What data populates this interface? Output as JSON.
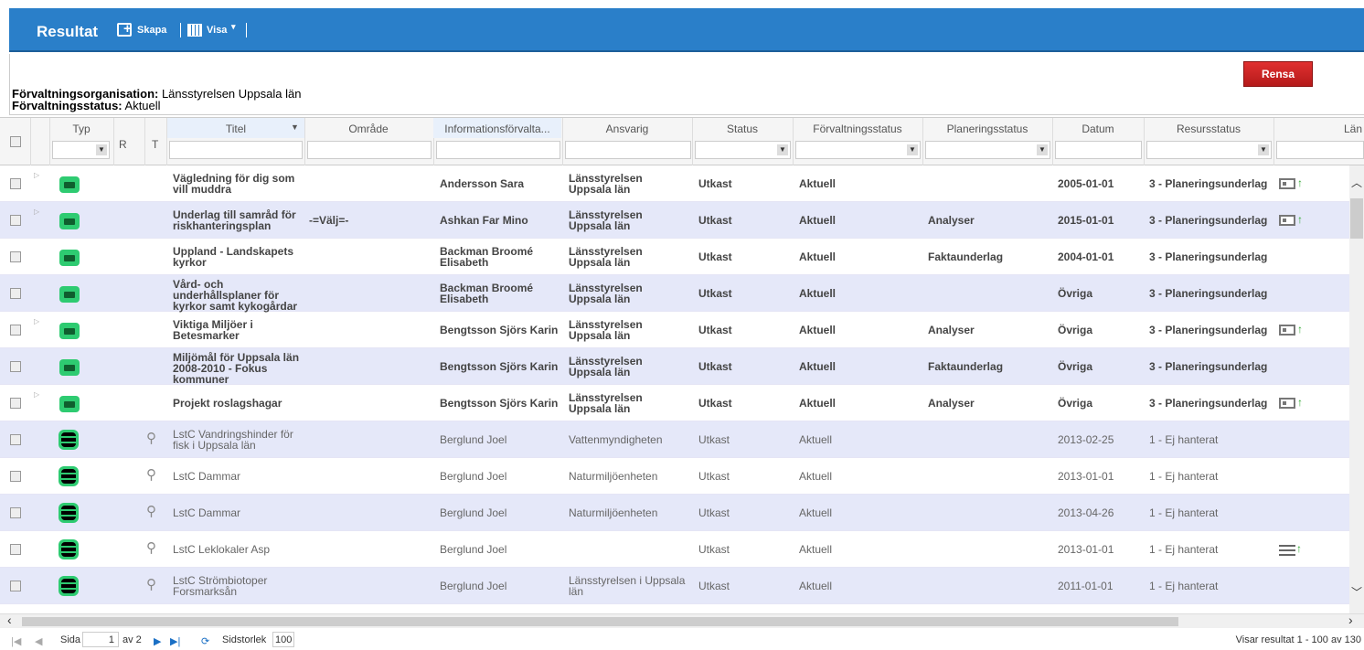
{
  "header": {
    "title": "Resultat",
    "skapa_label": "Skapa",
    "visa_label": "Visa",
    "visa_caret": "▾"
  },
  "filters": {
    "rensa_label": "Rensa",
    "org_label": "Förvaltningsorganisation:",
    "org_value": " Länsstyrelsen Uppsala län",
    "status_label": "Förvaltningsstatus:",
    "status_value": " Aktuell"
  },
  "columns": {
    "typ": "Typ",
    "r": "R",
    "t": "T",
    "titel": "Titel",
    "omrade": "Område",
    "info": "Informationsförvalta...",
    "ansvarig": "Ansvarig",
    "status": "Status",
    "forvaltningsstatus": "Förvaltningsstatus",
    "planeringsstatus": "Planeringsstatus",
    "datum": "Datum",
    "resursstatus": "Resursstatus",
    "lan": "Län"
  },
  "rows": [
    {
      "title1": "Vägledning för dig som",
      "title2": "vill muddra",
      "title3": "",
      "omrade": "",
      "info": "Andersson Sara",
      "ansv1": "Länsstyrelsen",
      "ansv2": "Uppsala län",
      "status": "Utkast",
      "fstatus": "Aktuell",
      "pstatus": "",
      "datum": "2005-01-01",
      "res": "3 - Planeringsunderlag"
    },
    {
      "title1": "Underlag till samråd för",
      "title2": "riskhanteringsplan",
      "title3": "",
      "omrade": "-=Välj=-",
      "info": "Ashkan Far Mino",
      "ansv1": "Länsstyrelsen",
      "ansv2": "Uppsala län",
      "status": "Utkast",
      "fstatus": "Aktuell",
      "pstatus": "Analyser",
      "datum": "2015-01-01",
      "res": "3 - Planeringsunderlag"
    },
    {
      "title1": "Uppland - Landskapets",
      "title2": "kyrkor",
      "title3": "",
      "omrade": "",
      "info": "Backman Broomé",
      "info2": "Elisabeth",
      "ansv1": "Länsstyrelsen",
      "ansv2": "Uppsala län",
      "status": "Utkast",
      "fstatus": "Aktuell",
      "pstatus": "Faktaunderlag",
      "datum": "2004-01-01",
      "res": "3 - Planeringsunderlag"
    },
    {
      "title1": "Vård- och",
      "title2": "underhållsplaner för",
      "title3": "kyrkor samt kykogårdar",
      "omrade": "",
      "info": "Backman Broomé",
      "info2": "Elisabeth",
      "ansv1": "Länsstyrelsen",
      "ansv2": "Uppsala län",
      "status": "Utkast",
      "fstatus": "Aktuell",
      "pstatus": "",
      "datum": "Övriga",
      "res": "3 - Planeringsunderlag"
    },
    {
      "title1": "Viktiga Miljöer i",
      "title2": "Betesmarker",
      "title3": "",
      "omrade": "",
      "info": "Bengtsson Sjörs Karin",
      "ansv1": "Länsstyrelsen",
      "ansv2": "Uppsala län",
      "status": "Utkast",
      "fstatus": "Aktuell",
      "pstatus": "Analyser",
      "datum": "Övriga",
      "res": "3 - Planeringsunderlag"
    },
    {
      "title1": "Miljömål för Uppsala län",
      "title2": "2008-2010 - Fokus",
      "title3": "kommuner",
      "omrade": "",
      "info": "Bengtsson Sjörs Karin",
      "ansv1": "Länsstyrelsen",
      "ansv2": "Uppsala län",
      "status": "Utkast",
      "fstatus": "Aktuell",
      "pstatus": "Faktaunderlag",
      "datum": "Övriga",
      "res": "3 - Planeringsunderlag"
    },
    {
      "title1": "Projekt roslagshagar",
      "title2": "",
      "title3": "",
      "omrade": "",
      "info": "Bengtsson Sjörs Karin",
      "ansv1": "Länsstyrelsen",
      "ansv2": "Uppsala län",
      "status": "Utkast",
      "fstatus": "Aktuell",
      "pstatus": "Analyser",
      "datum": "Övriga",
      "res": "3 - Planeringsunderlag"
    },
    {
      "title1": "LstC Vandringshinder för",
      "title2": "fisk i Uppsala län",
      "title3": "",
      "omrade": "",
      "info": "Berglund Joel",
      "ansv1": "Vattenmyndigheten",
      "ansv2": "",
      "status": "Utkast",
      "fstatus": "Aktuell",
      "pstatus": "",
      "datum": "2013-02-25",
      "res": "1 - Ej hanterat"
    },
    {
      "title1": "LstC Dammar",
      "title2": "",
      "title3": "",
      "omrade": "",
      "info": "Berglund Joel",
      "ansv1": "Naturmiljöenheten",
      "ansv2": "",
      "status": "Utkast",
      "fstatus": "Aktuell",
      "pstatus": "",
      "datum": "2013-01-01",
      "res": "1 - Ej hanterat"
    },
    {
      "title1": "LstC Dammar",
      "title2": "",
      "title3": "",
      "omrade": "",
      "info": "Berglund Joel",
      "ansv1": "Naturmiljöenheten",
      "ansv2": "",
      "status": "Utkast",
      "fstatus": "Aktuell",
      "pstatus": "",
      "datum": "2013-04-26",
      "res": "1 - Ej hanterat"
    },
    {
      "title1": "LstC Leklokaler Asp",
      "title2": "",
      "title3": "",
      "omrade": "",
      "info": "Berglund Joel",
      "ansv1": "",
      "ansv2": "",
      "status": "Utkast",
      "fstatus": "Aktuell",
      "pstatus": "",
      "datum": "2013-01-01",
      "res": "1 - Ej hanterat"
    },
    {
      "title1": "LstC Strömbiotoper",
      "title2": "Forsmarksån",
      "title3": "",
      "omrade": "",
      "info": "Berglund Joel",
      "ansv1": "Länsstyrelsen i Uppsala",
      "ansv2": "län",
      "status": "Utkast",
      "fstatus": "Aktuell",
      "pstatus": "",
      "datum": "2011-01-01",
      "res": "1 - Ej hanterat"
    }
  ],
  "pager": {
    "sida_label": "Sida",
    "page": "1",
    "av": "av 2",
    "size_label": "Sidstorlek",
    "size": "100",
    "summary": "Visar resultat 1 - 100 av 130"
  }
}
